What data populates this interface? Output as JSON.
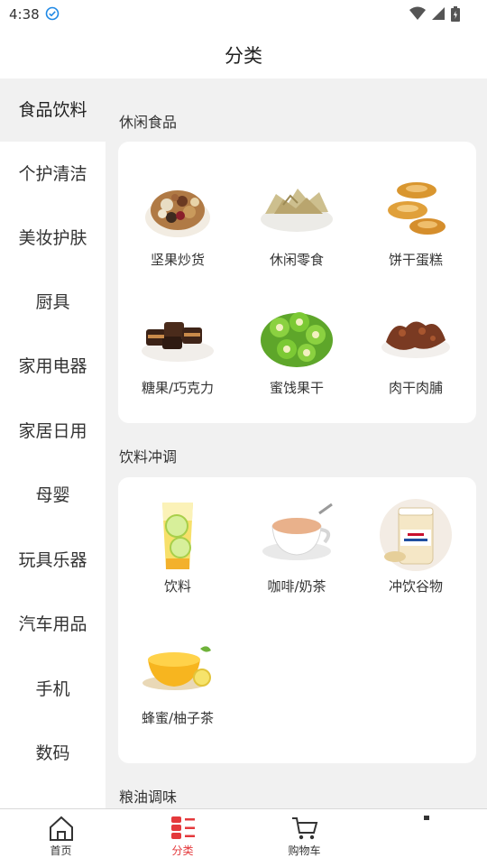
{
  "status": {
    "time": "4:38"
  },
  "header": {
    "title": "分类"
  },
  "sidebar": {
    "items": [
      {
        "label": "食品饮料"
      },
      {
        "label": "个护清洁"
      },
      {
        "label": "美妆护肤"
      },
      {
        "label": "厨具"
      },
      {
        "label": "家用电器"
      },
      {
        "label": "家居日用"
      },
      {
        "label": "母婴"
      },
      {
        "label": "玩具乐器"
      },
      {
        "label": "汽车用品"
      },
      {
        "label": "手机"
      },
      {
        "label": "数码"
      }
    ]
  },
  "sections": [
    {
      "title": "休闲食品",
      "items": [
        {
          "label": "坚果炒货",
          "icon": "nuts-image"
        },
        {
          "label": "休闲零食",
          "icon": "snack-chips-image"
        },
        {
          "label": "饼干蛋糕",
          "icon": "cookies-image"
        },
        {
          "label": "糖果/巧克力",
          "icon": "chocolate-image"
        },
        {
          "label": "蜜饯果干",
          "icon": "dried-kiwi-image"
        },
        {
          "label": "肉干肉脯",
          "icon": "jerky-image"
        }
      ]
    },
    {
      "title": "饮料冲调",
      "items": [
        {
          "label": "饮料",
          "icon": "lemonade-image"
        },
        {
          "label": "咖啡/奶茶",
          "icon": "coffee-cup-image"
        },
        {
          "label": "冲饮谷物",
          "icon": "oat-jar-image"
        },
        {
          "label": "蜂蜜/柚子茶",
          "icon": "honey-citron-image"
        }
      ]
    },
    {
      "title": "粮油调味"
    }
  ],
  "tabbar": {
    "items": [
      {
        "label": "首页",
        "icon": "home-icon"
      },
      {
        "label": "分类",
        "icon": "category-icon"
      },
      {
        "label": "购物车",
        "icon": "cart-icon"
      },
      {
        "label": "",
        "icon": "profile-icon"
      }
    ],
    "active_color": "#e4393c"
  }
}
